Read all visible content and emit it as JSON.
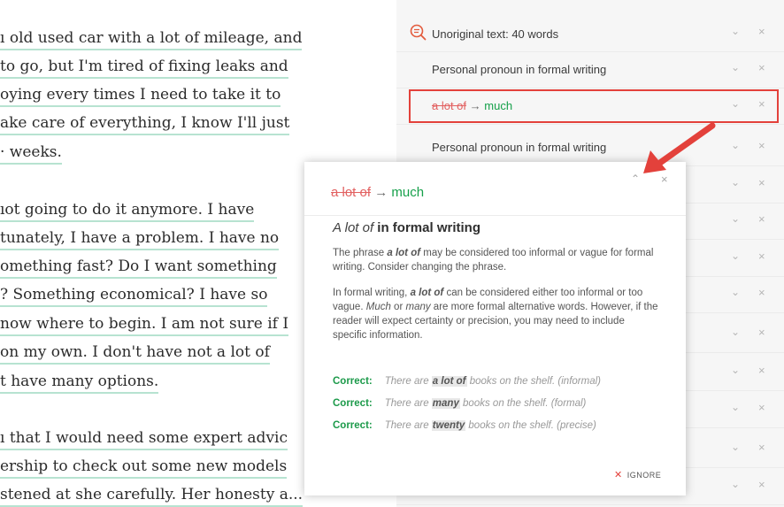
{
  "document": {
    "lines": [
      "ı old used car with a lot of mileage, and",
      "to go, but I'm tired of fixing leaks and",
      "oying every times I need to take it to",
      "ake care of everything, I know I'll just",
      "· weeks.",
      "ıot going to do it anymore. I have",
      "tunately, I have a problem. I have no",
      "omething fast? Do I want something",
      "? Something economical? I have so",
      "now where to begin. I am not sure if I",
      "on my own. I don't have not a lot of",
      "t have many options.",
      "ı that I would need some expert advic",
      "ership to check out some new models",
      "stened at she carefully. Her honesty a..."
    ]
  },
  "sidebar": {
    "cards": [
      {
        "label": "Unoriginal text: 40 words"
      },
      {
        "label": "Personal pronoun in formal writing"
      },
      {
        "strike": "a lot of",
        "arrow": "→",
        "replacement": "much"
      },
      {
        "label": "Personal pronoun in formal writing"
      },
      {
        "label": ""
      },
      {
        "label": ""
      },
      {
        "label": ""
      },
      {
        "label": ""
      },
      {
        "label": ""
      },
      {
        "label": ""
      },
      {
        "label": ""
      },
      {
        "label": ""
      },
      {
        "label": ""
      }
    ],
    "chevron": "⌄",
    "close": "×"
  },
  "popup": {
    "strike": "a lot of",
    "arrow": "→",
    "replacement": "much",
    "collapse_glyph": "⌃",
    "close_glyph": "×",
    "title_phrase": "A lot of",
    "title_rest": " in formal writing",
    "p1_a": "The phrase ",
    "p1_b": "a lot of",
    "p1_c": " may be considered too informal or vague for formal writing. Consider changing the phrase.",
    "p2_a": "In formal writing, ",
    "p2_b": "a lot of",
    "p2_c": " can be considered either too informal or too vague. ",
    "p2_d": "Much",
    "p2_e": " or ",
    "p2_f": "many",
    "p2_g": " are more formal alternative words. However, if the reader will expect certainty or precision, you may need to include specific information.",
    "examples": [
      {
        "label": "Correct:",
        "pre": "There are ",
        "key": "a lot of",
        "post": " books on the shelf. (informal)"
      },
      {
        "label": "Correct:",
        "pre": "There are ",
        "key": "many",
        "post": " books on the shelf. (formal)"
      },
      {
        "label": "Correct:",
        "pre": "There are ",
        "key": "twenty",
        "post": " books on the shelf. (precise)"
      }
    ],
    "ignore_label": "IGNORE"
  },
  "colors": {
    "accent_red": "#e3413b",
    "correct_green": "#1c9a4a",
    "underline_teal": "#b7e3d1"
  }
}
